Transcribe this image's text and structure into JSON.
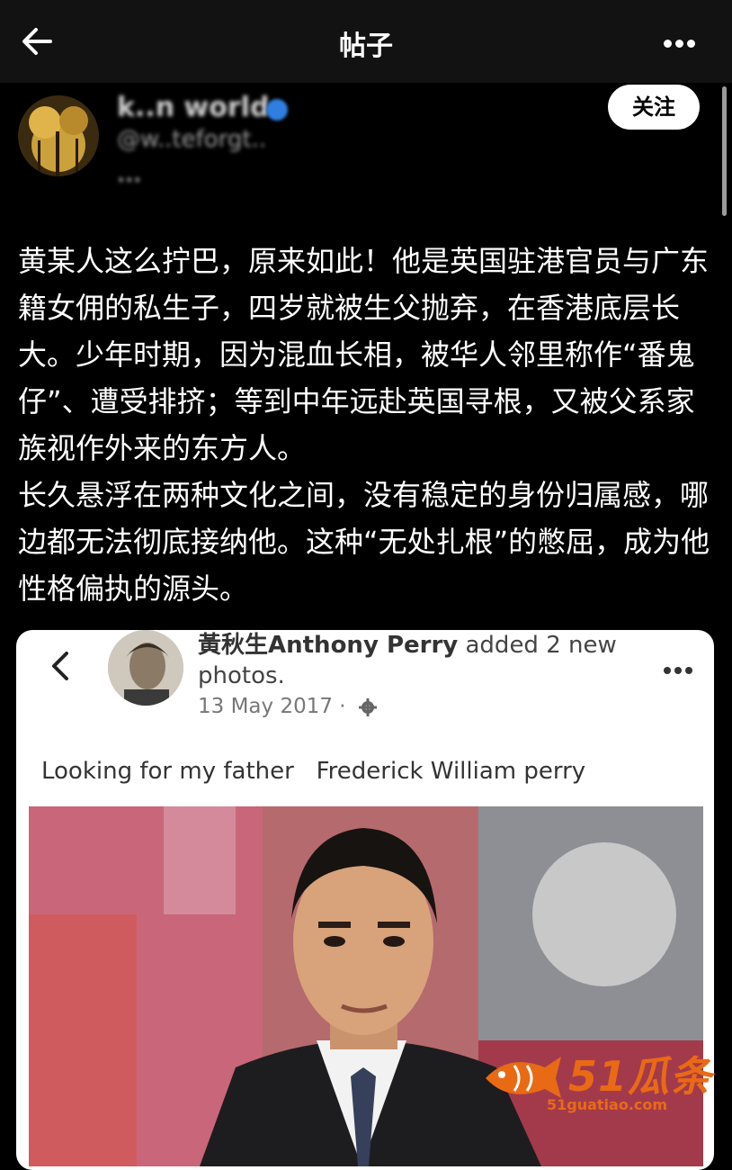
{
  "header": {
    "title": "帖子",
    "back_icon": "arrow-left-icon",
    "more_icon": "more-horizontal-icon"
  },
  "author": {
    "display_name": "k..n world",
    "handle": "@w..teforgt..",
    "meta": "..."
  },
  "follow_label": "关注",
  "post": {
    "paragraphs": [
      "黄某人这么拧巴，原来如此！他是英国驻港官员与广东籍女佣的私生子，四岁就被生父抛弃，在香港底层长大。少年时期，因为混血长相，被华人邻里称作“番鬼仔”、遭受排挤；等到中年远赴英国寻根，又被父系家族视作外来的东方人。",
      "长久悬浮在两种文化之间，没有稳定的身份归属感，哪边都无法彻底接纳他。这种“无处扎根”的憋屈，成为他性格偏执的源头。"
    ]
  },
  "embed": {
    "author": "黃秋生Anthony Perry",
    "action": " added 2 new photos.",
    "date": "13 May 2017 · ",
    "caption": "Looking for my father   Frederick William perry"
  },
  "watermark": {
    "brand": "51瓜条",
    "url": "51guatiao.com"
  },
  "colors": {
    "background": "#000000",
    "topbar": "#121212",
    "watermark": "#e96a15"
  }
}
